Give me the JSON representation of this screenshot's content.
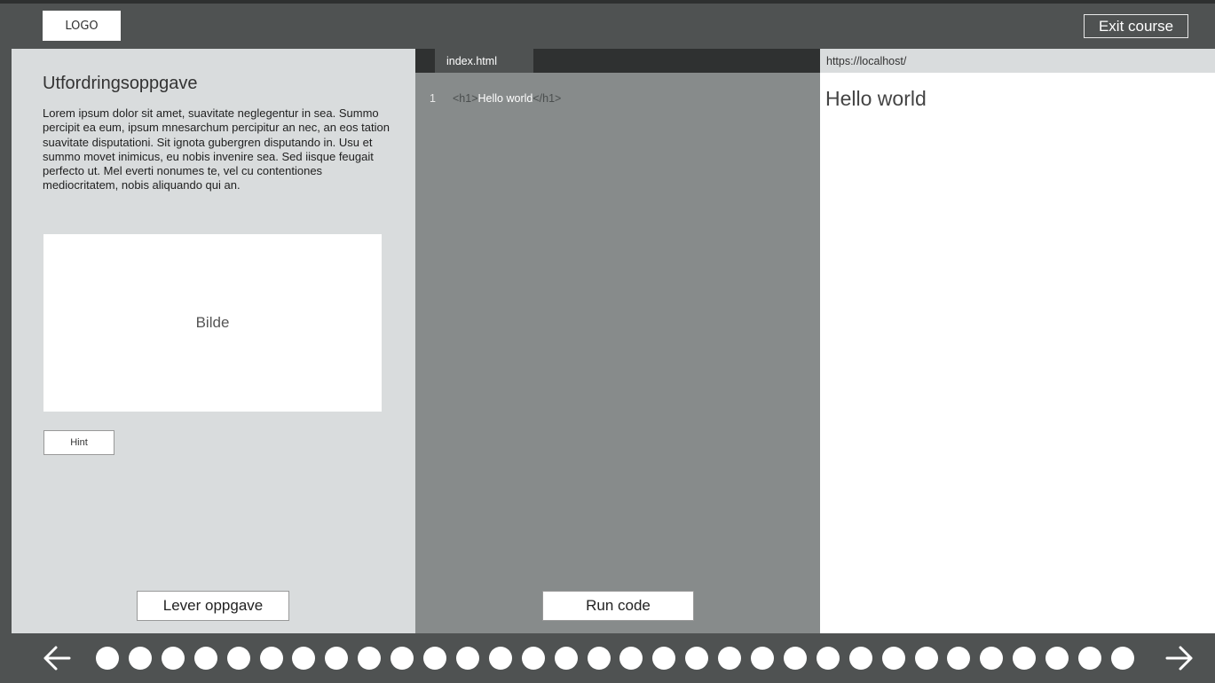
{
  "header": {
    "logo_text": "LOGO",
    "exit_label": "Exit course"
  },
  "task": {
    "title": "Utfordringsoppgave",
    "body": "Lorem ipsum dolor sit amet, suavitate neglegentur in sea. Summo percipit ea eum, ipsum mnesarchum percipitur an nec, an eos tation suavitate disputationi. Sit ignota gubergren disputando in. Usu et summo movet inimicus, eu nobis invenire sea. Sed iisque feugait perfecto ut. Mel everti nonumes te, vel cu contentiones mediocritatem, nobis aliquando qui an.",
    "image_placeholder": "Bilde",
    "hint_label": "Hint",
    "submit_label": "Lever oppgave"
  },
  "editor": {
    "tab_label": "index.html",
    "line_number": "1",
    "code_open_tag": "<h1>",
    "code_text": "Hello world",
    "code_close_tag": "</h1>",
    "run_label": "Run code"
  },
  "preview": {
    "url": "https://localhost/",
    "heading": "Hello world"
  },
  "navigation": {
    "prev_icon": "arrow-left-icon",
    "next_icon": "arrow-right-icon",
    "progress_dot_count": 32
  },
  "colors": {
    "chrome": "#4f5252",
    "panel": "#d9dcdd",
    "editor": "#878b8b",
    "editor_tabbar": "#2f3131"
  }
}
